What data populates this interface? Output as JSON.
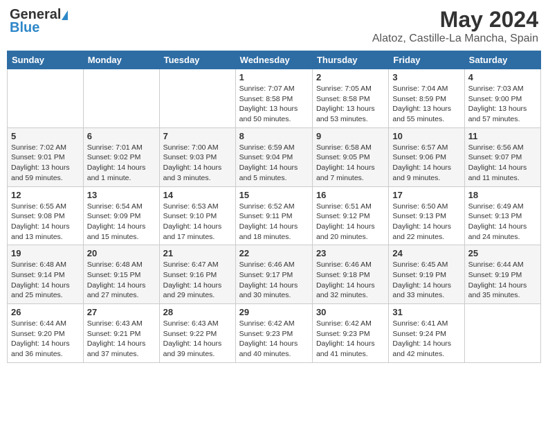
{
  "header": {
    "logo_general": "General",
    "logo_blue": "Blue",
    "month": "May 2024",
    "location": "Alatoz, Castille-La Mancha, Spain"
  },
  "weekdays": [
    "Sunday",
    "Monday",
    "Tuesday",
    "Wednesday",
    "Thursday",
    "Friday",
    "Saturday"
  ],
  "weeks": [
    [
      {
        "day": "",
        "sunrise": "",
        "sunset": "",
        "daylight": ""
      },
      {
        "day": "",
        "sunrise": "",
        "sunset": "",
        "daylight": ""
      },
      {
        "day": "",
        "sunrise": "",
        "sunset": "",
        "daylight": ""
      },
      {
        "day": "1",
        "sunrise": "Sunrise: 7:07 AM",
        "sunset": "Sunset: 8:58 PM",
        "daylight": "Daylight: 13 hours and 50 minutes."
      },
      {
        "day": "2",
        "sunrise": "Sunrise: 7:05 AM",
        "sunset": "Sunset: 8:58 PM",
        "daylight": "Daylight: 13 hours and 53 minutes."
      },
      {
        "day": "3",
        "sunrise": "Sunrise: 7:04 AM",
        "sunset": "Sunset: 8:59 PM",
        "daylight": "Daylight: 13 hours and 55 minutes."
      },
      {
        "day": "4",
        "sunrise": "Sunrise: 7:03 AM",
        "sunset": "Sunset: 9:00 PM",
        "daylight": "Daylight: 13 hours and 57 minutes."
      }
    ],
    [
      {
        "day": "5",
        "sunrise": "Sunrise: 7:02 AM",
        "sunset": "Sunset: 9:01 PM",
        "daylight": "Daylight: 13 hours and 59 minutes."
      },
      {
        "day": "6",
        "sunrise": "Sunrise: 7:01 AM",
        "sunset": "Sunset: 9:02 PM",
        "daylight": "Daylight: 14 hours and 1 minute."
      },
      {
        "day": "7",
        "sunrise": "Sunrise: 7:00 AM",
        "sunset": "Sunset: 9:03 PM",
        "daylight": "Daylight: 14 hours and 3 minutes."
      },
      {
        "day": "8",
        "sunrise": "Sunrise: 6:59 AM",
        "sunset": "Sunset: 9:04 PM",
        "daylight": "Daylight: 14 hours and 5 minutes."
      },
      {
        "day": "9",
        "sunrise": "Sunrise: 6:58 AM",
        "sunset": "Sunset: 9:05 PM",
        "daylight": "Daylight: 14 hours and 7 minutes."
      },
      {
        "day": "10",
        "sunrise": "Sunrise: 6:57 AM",
        "sunset": "Sunset: 9:06 PM",
        "daylight": "Daylight: 14 hours and 9 minutes."
      },
      {
        "day": "11",
        "sunrise": "Sunrise: 6:56 AM",
        "sunset": "Sunset: 9:07 PM",
        "daylight": "Daylight: 14 hours and 11 minutes."
      }
    ],
    [
      {
        "day": "12",
        "sunrise": "Sunrise: 6:55 AM",
        "sunset": "Sunset: 9:08 PM",
        "daylight": "Daylight: 14 hours and 13 minutes."
      },
      {
        "day": "13",
        "sunrise": "Sunrise: 6:54 AM",
        "sunset": "Sunset: 9:09 PM",
        "daylight": "Daylight: 14 hours and 15 minutes."
      },
      {
        "day": "14",
        "sunrise": "Sunrise: 6:53 AM",
        "sunset": "Sunset: 9:10 PM",
        "daylight": "Daylight: 14 hours and 17 minutes."
      },
      {
        "day": "15",
        "sunrise": "Sunrise: 6:52 AM",
        "sunset": "Sunset: 9:11 PM",
        "daylight": "Daylight: 14 hours and 18 minutes."
      },
      {
        "day": "16",
        "sunrise": "Sunrise: 6:51 AM",
        "sunset": "Sunset: 9:12 PM",
        "daylight": "Daylight: 14 hours and 20 minutes."
      },
      {
        "day": "17",
        "sunrise": "Sunrise: 6:50 AM",
        "sunset": "Sunset: 9:13 PM",
        "daylight": "Daylight: 14 hours and 22 minutes."
      },
      {
        "day": "18",
        "sunrise": "Sunrise: 6:49 AM",
        "sunset": "Sunset: 9:13 PM",
        "daylight": "Daylight: 14 hours and 24 minutes."
      }
    ],
    [
      {
        "day": "19",
        "sunrise": "Sunrise: 6:48 AM",
        "sunset": "Sunset: 9:14 PM",
        "daylight": "Daylight: 14 hours and 25 minutes."
      },
      {
        "day": "20",
        "sunrise": "Sunrise: 6:48 AM",
        "sunset": "Sunset: 9:15 PM",
        "daylight": "Daylight: 14 hours and 27 minutes."
      },
      {
        "day": "21",
        "sunrise": "Sunrise: 6:47 AM",
        "sunset": "Sunset: 9:16 PM",
        "daylight": "Daylight: 14 hours and 29 minutes."
      },
      {
        "day": "22",
        "sunrise": "Sunrise: 6:46 AM",
        "sunset": "Sunset: 9:17 PM",
        "daylight": "Daylight: 14 hours and 30 minutes."
      },
      {
        "day": "23",
        "sunrise": "Sunrise: 6:46 AM",
        "sunset": "Sunset: 9:18 PM",
        "daylight": "Daylight: 14 hours and 32 minutes."
      },
      {
        "day": "24",
        "sunrise": "Sunrise: 6:45 AM",
        "sunset": "Sunset: 9:19 PM",
        "daylight": "Daylight: 14 hours and 33 minutes."
      },
      {
        "day": "25",
        "sunrise": "Sunrise: 6:44 AM",
        "sunset": "Sunset: 9:19 PM",
        "daylight": "Daylight: 14 hours and 35 minutes."
      }
    ],
    [
      {
        "day": "26",
        "sunrise": "Sunrise: 6:44 AM",
        "sunset": "Sunset: 9:20 PM",
        "daylight": "Daylight: 14 hours and 36 minutes."
      },
      {
        "day": "27",
        "sunrise": "Sunrise: 6:43 AM",
        "sunset": "Sunset: 9:21 PM",
        "daylight": "Daylight: 14 hours and 37 minutes."
      },
      {
        "day": "28",
        "sunrise": "Sunrise: 6:43 AM",
        "sunset": "Sunset: 9:22 PM",
        "daylight": "Daylight: 14 hours and 39 minutes."
      },
      {
        "day": "29",
        "sunrise": "Sunrise: 6:42 AM",
        "sunset": "Sunset: 9:23 PM",
        "daylight": "Daylight: 14 hours and 40 minutes."
      },
      {
        "day": "30",
        "sunrise": "Sunrise: 6:42 AM",
        "sunset": "Sunset: 9:23 PM",
        "daylight": "Daylight: 14 hours and 41 minutes."
      },
      {
        "day": "31",
        "sunrise": "Sunrise: 6:41 AM",
        "sunset": "Sunset: 9:24 PM",
        "daylight": "Daylight: 14 hours and 42 minutes."
      },
      {
        "day": "",
        "sunrise": "",
        "sunset": "",
        "daylight": ""
      }
    ]
  ]
}
